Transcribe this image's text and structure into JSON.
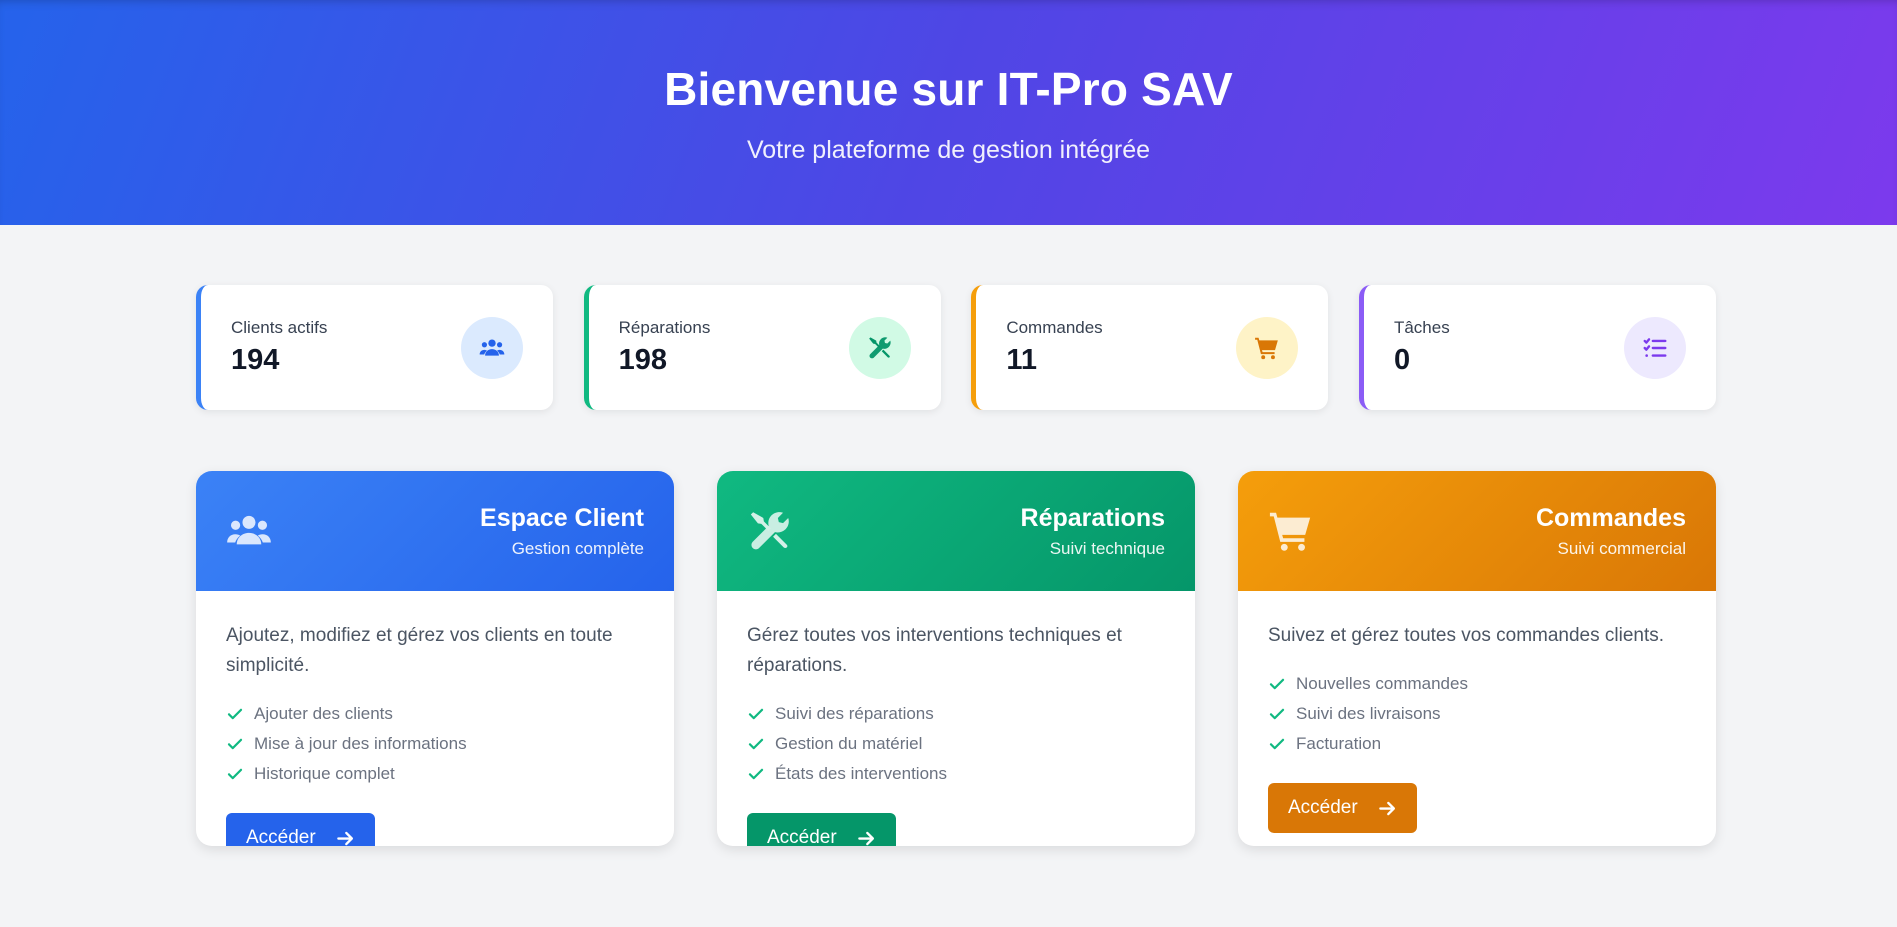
{
  "hero": {
    "title": "Bienvenue sur IT-Pro SAV",
    "subtitle": "Votre plateforme de gestion intégrée"
  },
  "stats": [
    {
      "label": "Clients actifs",
      "value": "194",
      "icon": "users-icon",
      "color": "#3b82f6",
      "bg": "#dbeafe",
      "fg": "#2563eb"
    },
    {
      "label": "Réparations",
      "value": "198",
      "icon": "tools-icon",
      "color": "#10b981",
      "bg": "#d1fae5",
      "fg": "#059669"
    },
    {
      "label": "Commandes",
      "value": "11",
      "icon": "cart-icon",
      "color": "#f59e0b",
      "bg": "#fef3c7",
      "fg": "#d97706"
    },
    {
      "label": "Tâches",
      "value": "0",
      "icon": "tasks-icon",
      "color": "#8b5cf6",
      "bg": "#ede9fe",
      "fg": "#7c3aed"
    }
  ],
  "cards": [
    {
      "title": "Espace Client",
      "subtitle": "Gestion complète",
      "icon": "users-icon",
      "description": "Ajoutez, modifiez et gérez vos clients en toute simplicité.",
      "features": [
        "Ajouter des clients",
        "Mise à jour des informations",
        "Historique complet"
      ],
      "button": "Accéder",
      "color_from": "#3b82f6",
      "color_to": "#2563eb",
      "button_color": "#2563eb"
    },
    {
      "title": "Réparations",
      "subtitle": "Suivi technique",
      "icon": "tools-icon",
      "description": "Gérez toutes vos interventions techniques et réparations.",
      "features": [
        "Suivi des réparations",
        "Gestion du matériel",
        "États des interventions"
      ],
      "button": "Accéder",
      "color_from": "#10b981",
      "color_to": "#059669",
      "button_color": "#059669"
    },
    {
      "title": "Commandes",
      "subtitle": "Suivi commercial",
      "icon": "cart-icon",
      "description": "Suivez et gérez toutes vos commandes clients.",
      "features": [
        "Nouvelles commandes",
        "Suivi des livraisons",
        "Facturation"
      ],
      "button": "Accéder",
      "color_from": "#f59e0b",
      "color_to": "#d97706",
      "button_color": "#d97706"
    }
  ],
  "check_color": "#10b981"
}
